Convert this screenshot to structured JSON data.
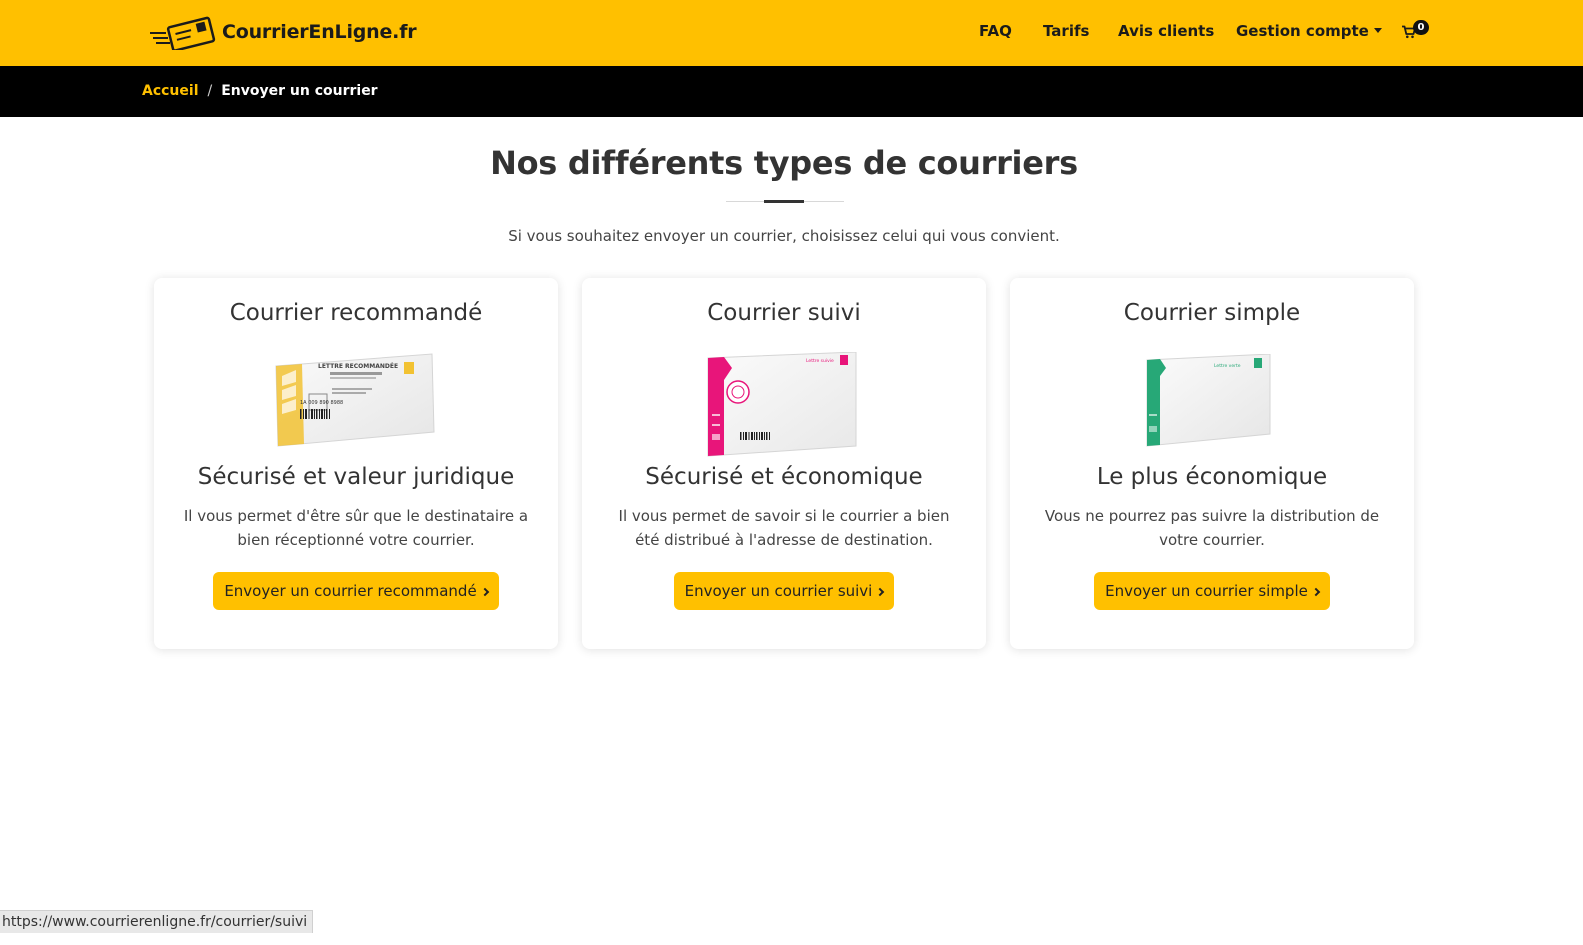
{
  "logo": {
    "text": "CourrierEnLigne.fr"
  },
  "nav": {
    "items": [
      "FAQ",
      "Tarifs",
      "Avis clients",
      "Gestion compte"
    ],
    "cart_count": "0"
  },
  "breadcrumb": {
    "home": "Accueil",
    "separator": "/",
    "current": "Envoyer un courrier"
  },
  "main": {
    "title": "Nos différents types de courriers",
    "subtitle": "Si vous souhaitez envoyer un courrier, choisissez celui qui vous convient."
  },
  "cards": [
    {
      "title": "Courrier recommandé",
      "headline": "Sécurisé et valeur juridique",
      "description": "Il vous permet d'être sûr que le destinataire a bien réceptionné votre courrier.",
      "button": "Envoyer un courrier recommandé",
      "envelope_label": "LETTRE RECOMMANDÉE",
      "envelope_number": "1A 009 890 8988",
      "accent": "#f2c232"
    },
    {
      "title": "Courrier suivi",
      "headline": "Sécurisé et économique",
      "description": "Il vous permet de savoir si le courrier a bien été distribué à l'adresse de destination.",
      "button": "Envoyer un courrier suivi",
      "envelope_label": "Lettre suivie",
      "accent": "#e8157a"
    },
    {
      "title": "Courrier simple",
      "headline": "Le plus économique",
      "description": "Vous ne pourrez pas suivre la distribution de votre courrier.",
      "button": "Envoyer un courrier simple",
      "envelope_label": "Lettre verte",
      "accent": "#27a877"
    }
  ],
  "statusbar": {
    "url": "https://www.courrierenligne.fr/courrier/suivi"
  },
  "colors": {
    "brand": "#ffc000",
    "dark": "#000000",
    "text": "#333333"
  }
}
